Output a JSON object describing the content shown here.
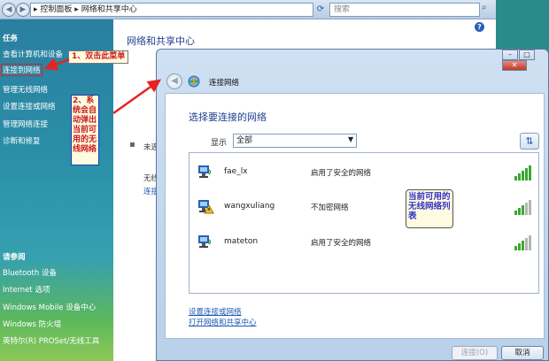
{
  "explorer": {
    "breadcrumb": [
      "控制面板",
      "网络和共享中心"
    ],
    "search_placeholder": "搜索"
  },
  "sidebar": {
    "tasks_heading": "任务",
    "tasks": [
      "查看计算机和设备",
      "连接到网络",
      "管理无线网络",
      "设置连接或网络",
      "管理网络连接",
      "诊断和修复"
    ],
    "see_also_heading": "请参阅",
    "see_also": [
      "Bluetooth 设备",
      "Internet 选项",
      "Windows Mobile 设备中心",
      "Windows 防火墙",
      "英特尔(R) PROSet/无线工具"
    ]
  },
  "main": {
    "title": "网络和共享中心",
    "fragment_1": "未连",
    "fragment_2": "无线",
    "fragment_3": "连接"
  },
  "annotations": {
    "callout_1": "1、双击此菜单",
    "callout_2": "2、系统会自动弹出当前可用的无线网络",
    "callout_3": "当前可用的无线网络列表"
  },
  "dialog": {
    "title": "连接网络",
    "heading": "选择要连接的网络",
    "show_label": "显示",
    "show_value": "全部",
    "networks": [
      {
        "name": "fae_lx",
        "status": "启用了安全的网络",
        "signal": 5
      },
      {
        "name": "wangxuliang",
        "status": "不加密网络",
        "signal": 3
      },
      {
        "name": "mateton",
        "status": "启用了安全的网络",
        "signal": 3
      }
    ],
    "link_setup": "设置连接或网络",
    "link_open": "打开网络和共享中心",
    "connect_label": "连接(O)",
    "cancel_label": "取消"
  },
  "colors": {
    "accent_title": "#1e3f8f",
    "link": "#1f5bb3",
    "signal_on": "#3aa832",
    "annotation_red": "#cc1a1a"
  }
}
